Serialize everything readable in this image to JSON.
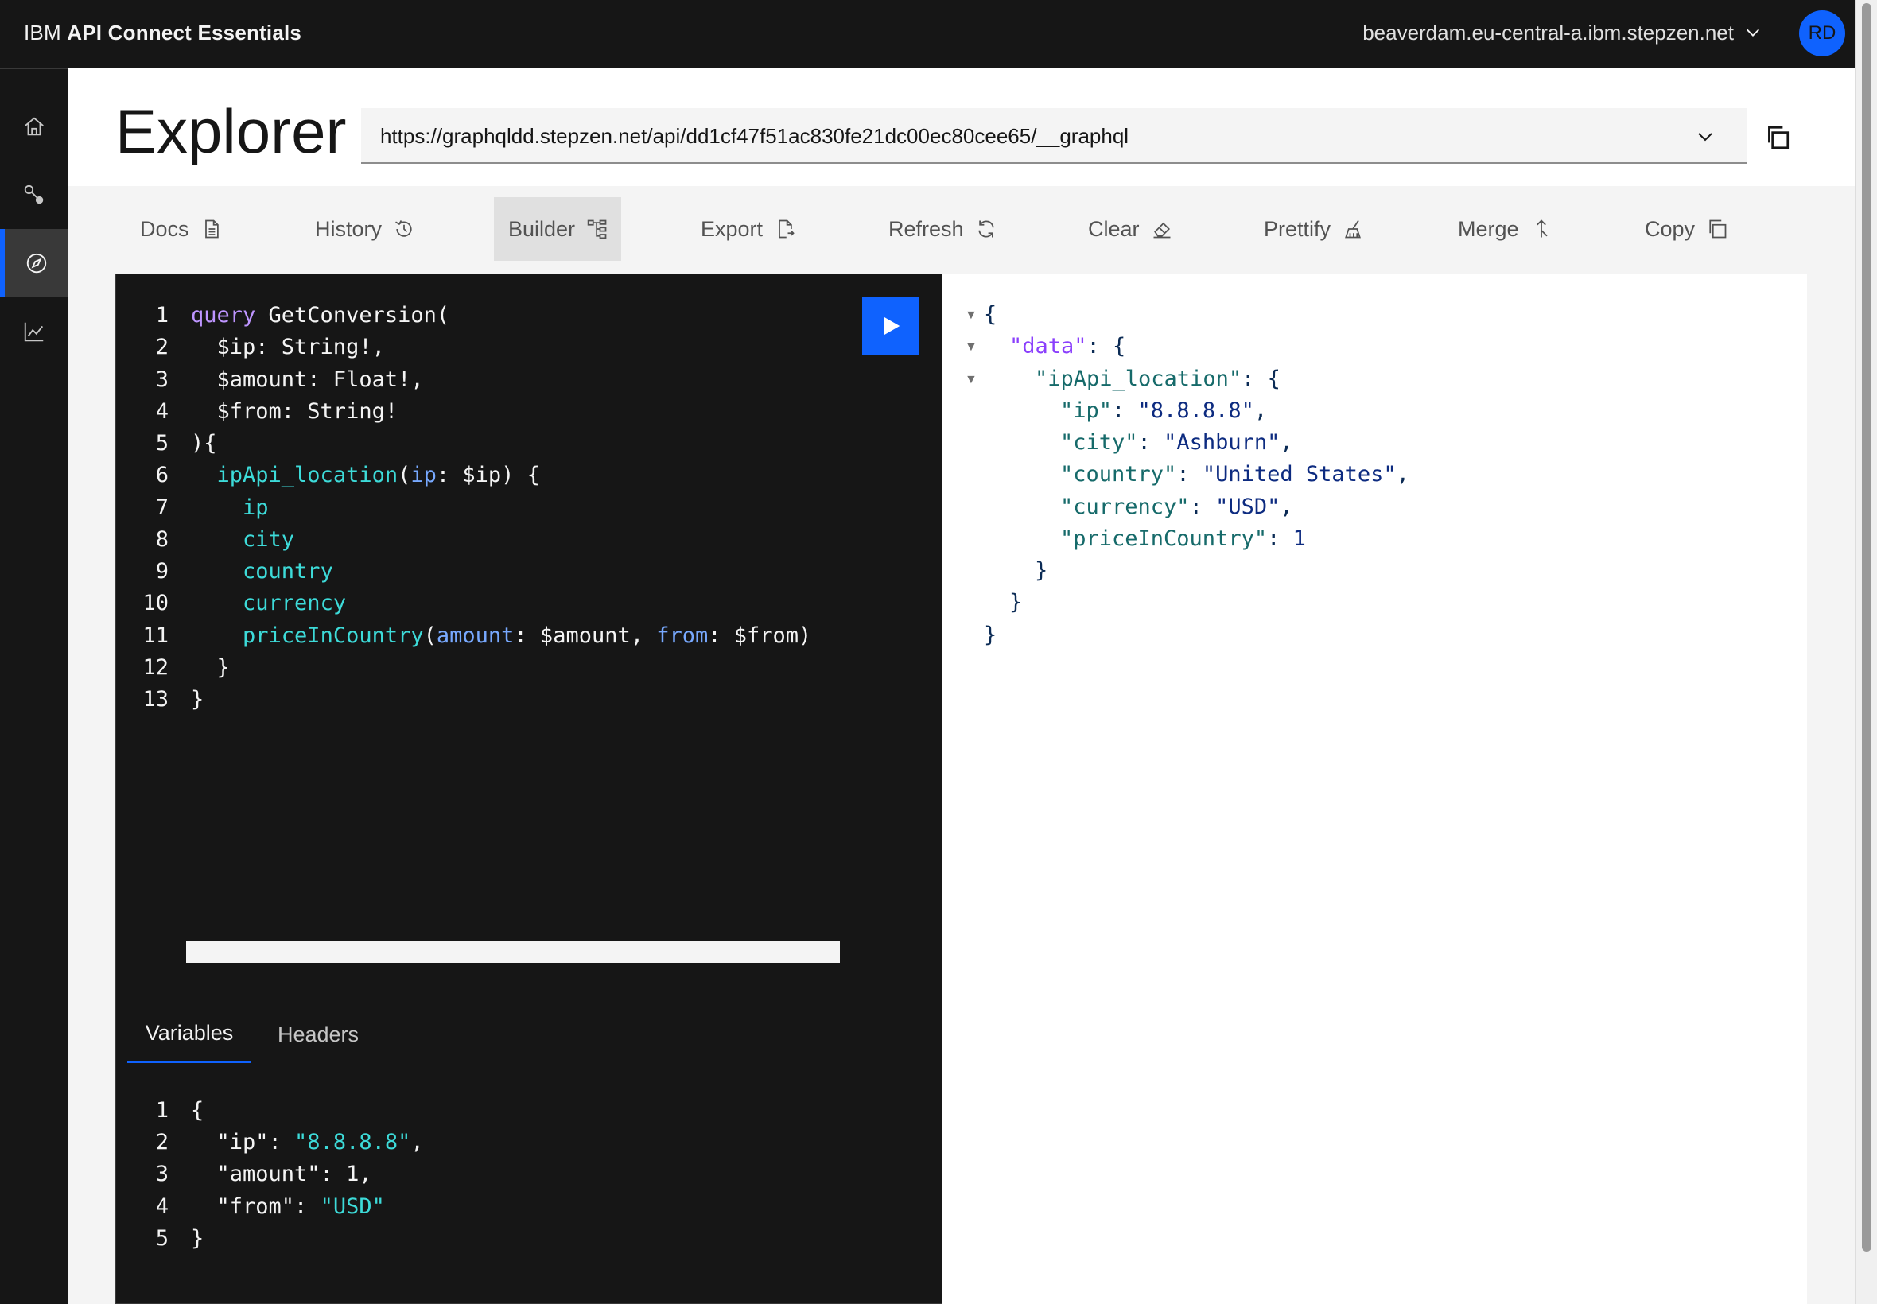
{
  "topbar": {
    "brand_prefix": "IBM",
    "brand_name": "API Connect Essentials",
    "environment": "beaverdam.eu-central-a.ibm.stepzen.net",
    "avatar_initials": "RD"
  },
  "sidenav": {
    "items": [
      {
        "name": "home",
        "icon": "home-icon",
        "active": false
      },
      {
        "name": "connect",
        "icon": "connection-icon",
        "active": false
      },
      {
        "name": "explorer",
        "icon": "compass-icon",
        "active": true
      },
      {
        "name": "analytics",
        "icon": "chart-line-icon",
        "active": false
      }
    ]
  },
  "header": {
    "title": "Explorer",
    "endpoint_url": "https://graphqldd.stepzen.net/api/dd1cf47f51ac830fe21dc00ec80cee65/__graphql"
  },
  "toolbar": {
    "docs": "Docs",
    "history": "History",
    "builder": "Builder",
    "export": "Export",
    "refresh": "Refresh",
    "clear": "Clear",
    "prettify": "Prettify",
    "merge": "Merge",
    "copy": "Copy"
  },
  "editor": {
    "line_numbers": [
      "1",
      "2",
      "3",
      "4",
      "5",
      "6",
      "7",
      "8",
      "9",
      "10",
      "11",
      "12",
      "13"
    ],
    "q1_kw": "query",
    "q1_rest": " GetConversion(",
    "q2": "  $ip: String!,",
    "q3": "  $amount: Float!,",
    "q4": "  $from: String!",
    "q5": "){",
    "q6_field": "ipApi_location",
    "q6_open": "(",
    "q6_arg": "ip",
    "q6_rest": ": $ip) {",
    "q7": "ip",
    "q8": "city",
    "q9": "country",
    "q10": "currency",
    "q11_field": "priceInCountry",
    "q11_open": "(",
    "q11_arg1": "amount",
    "q11_mid": ": $amount, ",
    "q11_arg2": "from",
    "q11_rest": ": $from)",
    "q12": "  }",
    "q13": "}"
  },
  "bottom_tabs": {
    "variables": "Variables",
    "headers": "Headers"
  },
  "variables": {
    "line_numbers": [
      "1",
      "2",
      "3",
      "4",
      "5"
    ],
    "v1": "{",
    "v2_key": "  \"ip\": ",
    "v2_val": "\"8.8.8.8\"",
    "v2_end": ",",
    "v3": "  \"amount\": 1,",
    "v4_key": "  \"from\": ",
    "v4_val": "\"USD\"",
    "v5": "}"
  },
  "result": {
    "r1": "{",
    "r2_key": "\"data\"",
    "r2_rest": ": {",
    "r3_key": "\"ipApi_location\"",
    "r3_rest": ": {",
    "r4_key": "\"ip\"",
    "r4_sep": ": ",
    "r4_val": "\"8.8.8.8\"",
    "r5_key": "\"city\"",
    "r5_sep": ": ",
    "r5_val": "\"Ashburn\"",
    "r6_key": "\"country\"",
    "r6_sep": ": ",
    "r6_val": "\"United States\"",
    "r7_key": "\"currency\"",
    "r7_sep": ": ",
    "r7_val": "\"USD\"",
    "r8_key": "\"priceInCountry\"",
    "r8_sep": ": ",
    "r8_val": "1",
    "r9": "}",
    "r10": "}",
    "r11": "}",
    "comma": ","
  },
  "colors": {
    "accent": "#0f62fe",
    "shell_bg": "#161616"
  }
}
